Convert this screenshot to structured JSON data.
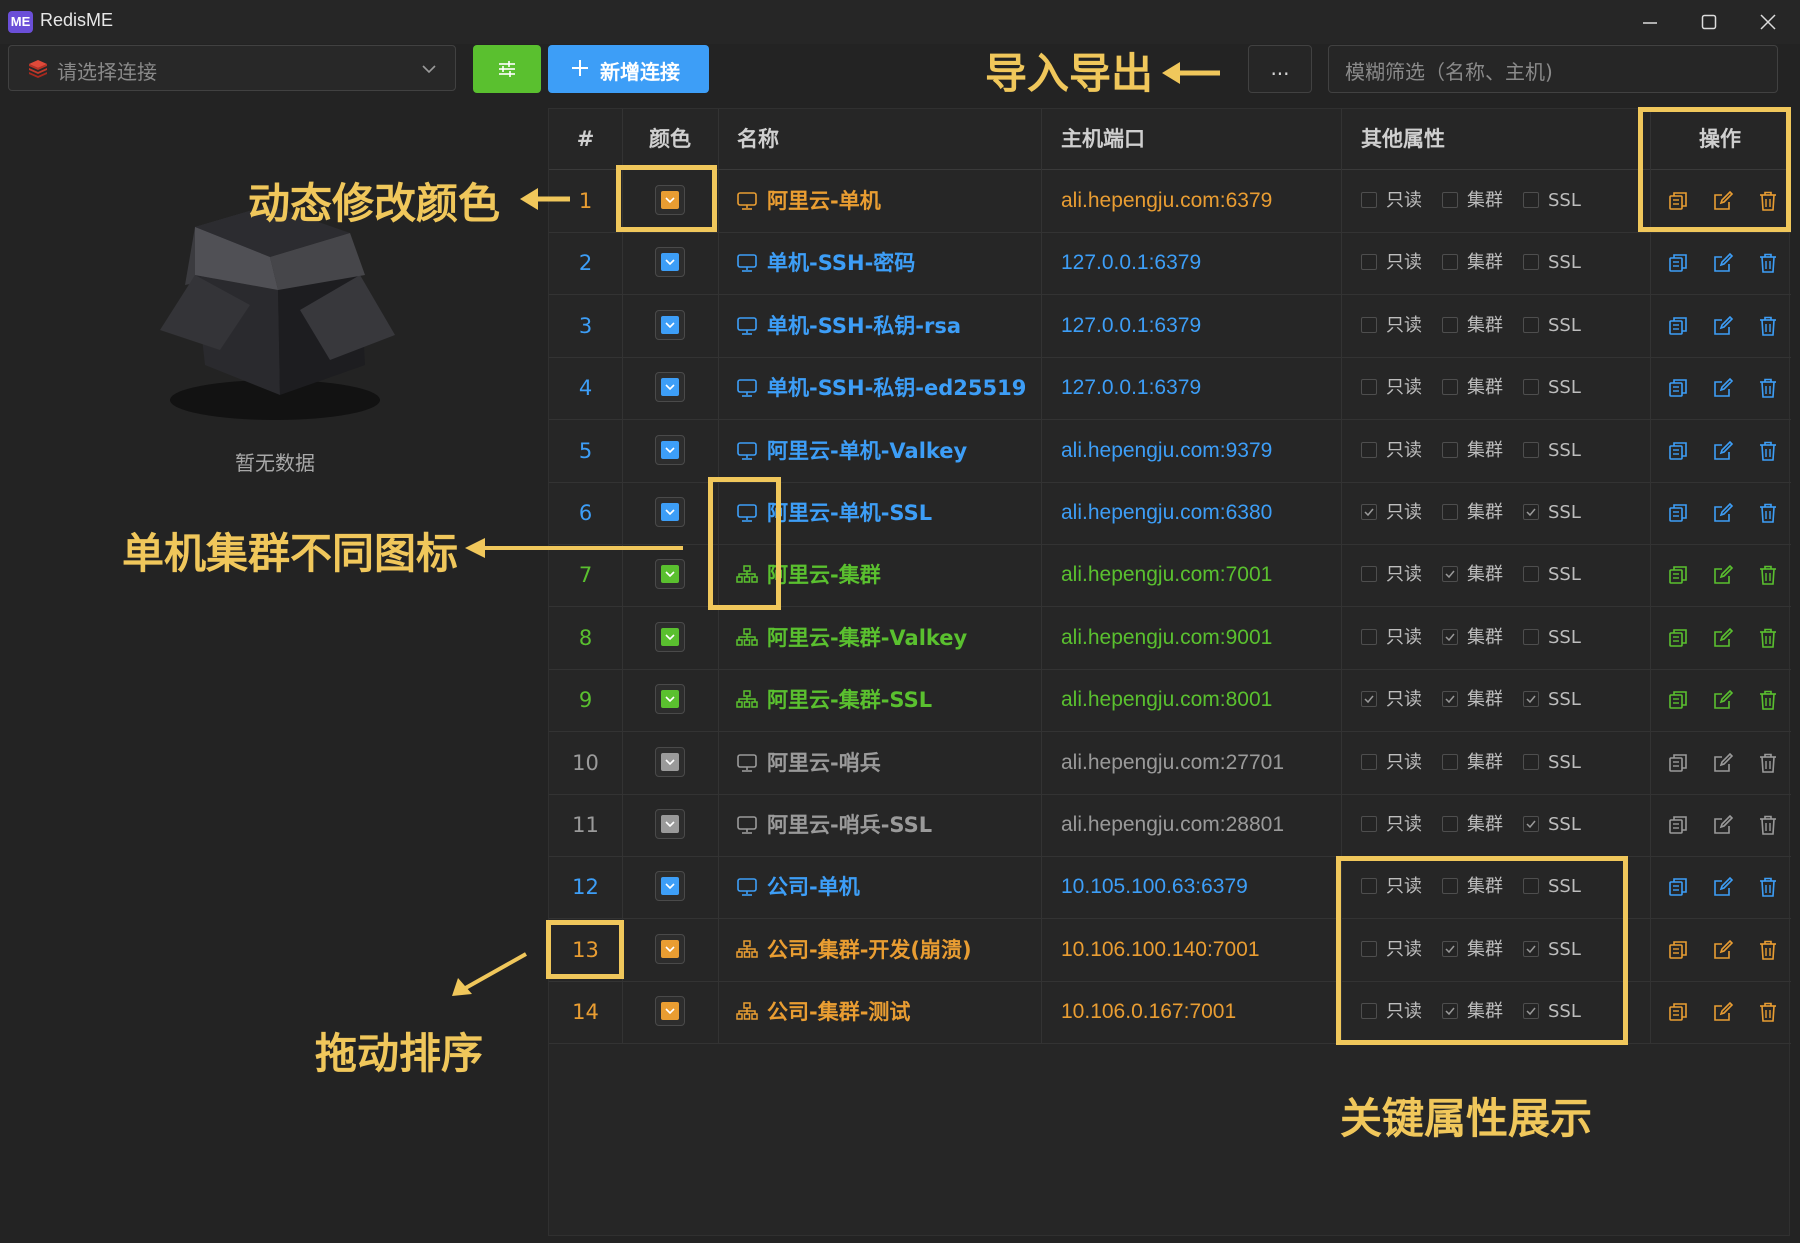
{
  "app": {
    "logo_text": "ME",
    "title": "RedisME"
  },
  "toolbar": {
    "connection_placeholder": "请选择连接",
    "new_connection_label": "新增连接",
    "more_label": "...",
    "search_placeholder": "模糊筛选（名称、主机)"
  },
  "empty_state": {
    "text": "暂无数据"
  },
  "table": {
    "headers": {
      "index": "#",
      "color": "颜色",
      "name": "名称",
      "host": "主机端口",
      "attrs": "其他属性",
      "actions": "操作"
    },
    "attr_labels": {
      "readonly": "只读",
      "cluster": "集群",
      "ssl": "SSL"
    },
    "colors": {
      "orange": "#e99d32",
      "blue": "#3d9ef7",
      "green": "#5ac02f",
      "gray": "#9a9a9a"
    },
    "rows": [
      {
        "index": "1",
        "color": "orange",
        "type": "single",
        "name": "阿里云-单机",
        "host": "ali.hepengju.com:6379",
        "readonly": false,
        "cluster": false,
        "ssl": false
      },
      {
        "index": "2",
        "color": "blue",
        "type": "single",
        "name": "单机-SSH-密码",
        "host": "127.0.0.1:6379",
        "readonly": false,
        "cluster": false,
        "ssl": false
      },
      {
        "index": "3",
        "color": "blue",
        "type": "single",
        "name": "单机-SSH-私钥-rsa",
        "host": "127.0.0.1:6379",
        "readonly": false,
        "cluster": false,
        "ssl": false
      },
      {
        "index": "4",
        "color": "blue",
        "type": "single",
        "name": "单机-SSH-私钥-ed25519",
        "host": "127.0.0.1:6379",
        "readonly": false,
        "cluster": false,
        "ssl": false
      },
      {
        "index": "5",
        "color": "blue",
        "type": "single",
        "name": "阿里云-单机-Valkey",
        "host": "ali.hepengju.com:9379",
        "readonly": false,
        "cluster": false,
        "ssl": false
      },
      {
        "index": "6",
        "color": "blue",
        "type": "single",
        "name": "阿里云-单机-SSL",
        "host": "ali.hepengju.com:6380",
        "readonly": true,
        "cluster": false,
        "ssl": true
      },
      {
        "index": "7",
        "color": "green",
        "type": "cluster",
        "name": "阿里云-集群",
        "host": "ali.hepengju.com:7001",
        "readonly": false,
        "cluster": true,
        "ssl": false
      },
      {
        "index": "8",
        "color": "green",
        "type": "cluster",
        "name": "阿里云-集群-Valkey",
        "host": "ali.hepengju.com:9001",
        "readonly": false,
        "cluster": true,
        "ssl": false
      },
      {
        "index": "9",
        "color": "green",
        "type": "cluster",
        "name": "阿里云-集群-SSL",
        "host": "ali.hepengju.com:8001",
        "readonly": true,
        "cluster": true,
        "ssl": true
      },
      {
        "index": "10",
        "color": "gray",
        "type": "single",
        "name": "阿里云-哨兵",
        "host": "ali.hepengju.com:27701",
        "readonly": false,
        "cluster": false,
        "ssl": false
      },
      {
        "index": "11",
        "color": "gray",
        "type": "single",
        "name": "阿里云-哨兵-SSL",
        "host": "ali.hepengju.com:28801",
        "readonly": false,
        "cluster": false,
        "ssl": true
      },
      {
        "index": "12",
        "color": "blue",
        "type": "single",
        "name": "公司-单机",
        "host": "10.105.100.63:6379",
        "readonly": false,
        "cluster": false,
        "ssl": false
      },
      {
        "index": "13",
        "color": "orange",
        "type": "cluster",
        "name": "公司-集群-开发(崩溃)",
        "host": "10.106.100.140:7001",
        "readonly": false,
        "cluster": true,
        "ssl": true
      },
      {
        "index": "14",
        "color": "orange",
        "type": "cluster",
        "name": "公司-集群-测试",
        "host": "10.106.0.167:7001",
        "readonly": false,
        "cluster": true,
        "ssl": true
      }
    ]
  },
  "annotations": {
    "import_export": "导入导出",
    "dynamic_color": "动态修改颜色",
    "icon_diff": "单机集群不同图标",
    "drag_sort": "拖动排序",
    "key_attrs": "关键属性展示",
    "accent_color": "#f0c75b"
  }
}
